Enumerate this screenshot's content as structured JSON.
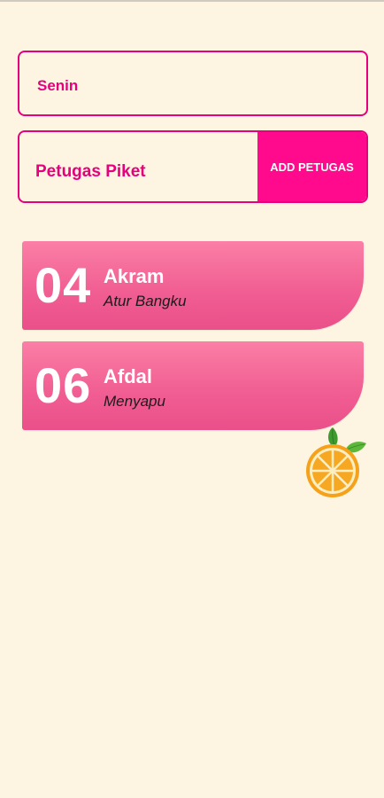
{
  "day": {
    "value": "Senin"
  },
  "officer": {
    "label": "Petugas Piket",
    "add_button": "ADD PETUGAS"
  },
  "cards": [
    {
      "number": "04",
      "name": "Akram",
      "task": "Atur Bangku"
    },
    {
      "number": "06",
      "name": "Afdal",
      "task": "Menyapu"
    }
  ],
  "colors": {
    "accent": "#e6007e",
    "button": "#ff0a8c",
    "card_top": "#fb7fa6",
    "card_bottom": "#ea4f89",
    "background": "#fdf5e2"
  },
  "icons": {
    "decoration": "orange-icon"
  }
}
